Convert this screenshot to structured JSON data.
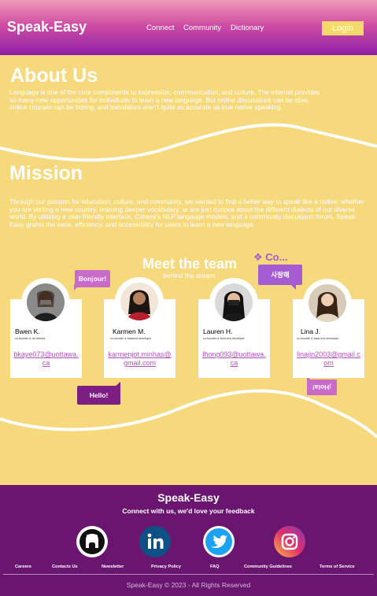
{
  "header": {
    "brand": "Speak-Easy",
    "nav": [
      "Connect",
      "Community",
      "Dictionary"
    ],
    "login_label": "Login"
  },
  "about": {
    "title": "About Us",
    "text": "Language is one of the core components to expression, communication, and culture. The internet provides so many new opportunities for individuals to learn a new language. But online discussions can be slow, online courses can be boring, and translators aren't quite as accurate as true native speaking."
  },
  "mission": {
    "title": "Mission",
    "text": "Through our passion for education, culture, and community, we wanted to find a better way to speak like a native: whether you are visiting a new country, learning deeper vocabulary, or are just curious about the different dialects of our diverse world. By utilizing a user-friendly interface, Cohere's NLP langauge models, and a community discussion forum, Speak-Easy grants the ease, efficiency, and accessibility for users to learn a new language."
  },
  "team": {
    "title": "Meet the team",
    "subtitle": "behind the dream",
    "co_label": "❖ Co...",
    "bubbles": [
      "Bonjour!",
      "사랑해",
      "Hello!",
      "¡Hola!"
    ],
    "members": [
      {
        "name": "Bwen K.",
        "role": "co-founder & art director",
        "email": "bkaye073@uottawa.ca"
      },
      {
        "name": "Karmen M.",
        "role": "co-founder & backend developer",
        "email": "karmenjot.minhas@gmail.com"
      },
      {
        "name": "Lauren H.",
        "role": "co-founder & front-end developer",
        "email": "lhong093@uottawa.ca"
      },
      {
        "name": "Lina J.",
        "role": "co-founder & back-end developer",
        "email": "linajin2003@gmail.com"
      }
    ]
  },
  "footer": {
    "brand": "Speak-Easy",
    "tagline": "Connect with us, we'd love your feedback",
    "social": [
      "github-icon",
      "linkedin-icon",
      "twitter-icon",
      "instagram-icon"
    ],
    "links": [
      "Careers",
      "Contacts Us",
      "Newsletter",
      "Privacy Policy",
      "FAQ",
      "Community Guidelines",
      "Terms of Service"
    ],
    "copyright": "Speak-Easy © 2023 - All Rights Reserved"
  },
  "colors": {
    "header_top": "#ee9ab8",
    "header_bottom": "#8e1fa9",
    "page_yellow": "#f5d97c",
    "login_yellow": "#f5d96a",
    "footer_purple": "#6a1570",
    "accent_pink": "#c86bc9",
    "accent_dark": "#7c1e82",
    "link_purple": "#b451c0"
  }
}
